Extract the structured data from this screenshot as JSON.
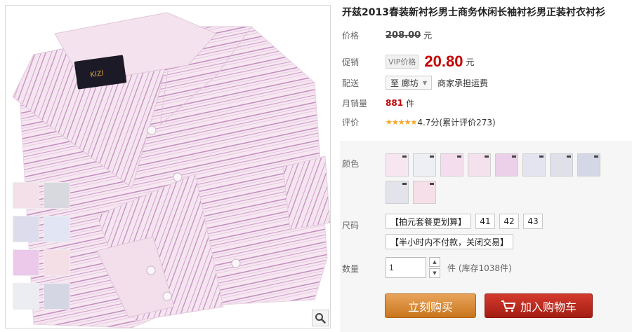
{
  "product": {
    "title": "开兹2013春装新衬衫男士商务休闲长袖衬衫男正装衬衣衬衫",
    "brand_label": "KIZI"
  },
  "price_row": {
    "label": "价格",
    "value": "208.00",
    "unit": "元"
  },
  "promo_row": {
    "label": "促销",
    "tag": "VIP价格",
    "value": "20.80",
    "unit": "元"
  },
  "delivery_row": {
    "label": "配送",
    "to": "至",
    "destination": "廊坊",
    "note": "商家承担运费"
  },
  "sales_row": {
    "label": "月销量",
    "value": "881",
    "unit": "件"
  },
  "review_row": {
    "label": "评价",
    "stars": "★★★★★",
    "score": "4.7分",
    "count_text": "(累计评价273)"
  },
  "sku": {
    "color_label": "颜色",
    "colors": [
      "pink",
      "white",
      "pink",
      "pink",
      "lilac",
      "blue",
      "grey",
      "navy",
      "grey",
      "pink"
    ],
    "size_label": "尺码",
    "sizes": [
      "【拍元套餐更划算】",
      "41",
      "42",
      "43",
      "【半小时内不付款，关闭交易】"
    ],
    "qty_label": "数量",
    "qty_value": "1",
    "stock_text": "件 (库存1038件)"
  },
  "buttons": {
    "buy_now": "立刻购买",
    "add_cart": "加入购物车"
  },
  "colors": {
    "price_red": "#c40000",
    "buy_orange": "#d88a34",
    "cart_red": "#c0281c",
    "shirt_pink": "#f6e4ef",
    "stripe": "#c9a2c8"
  }
}
